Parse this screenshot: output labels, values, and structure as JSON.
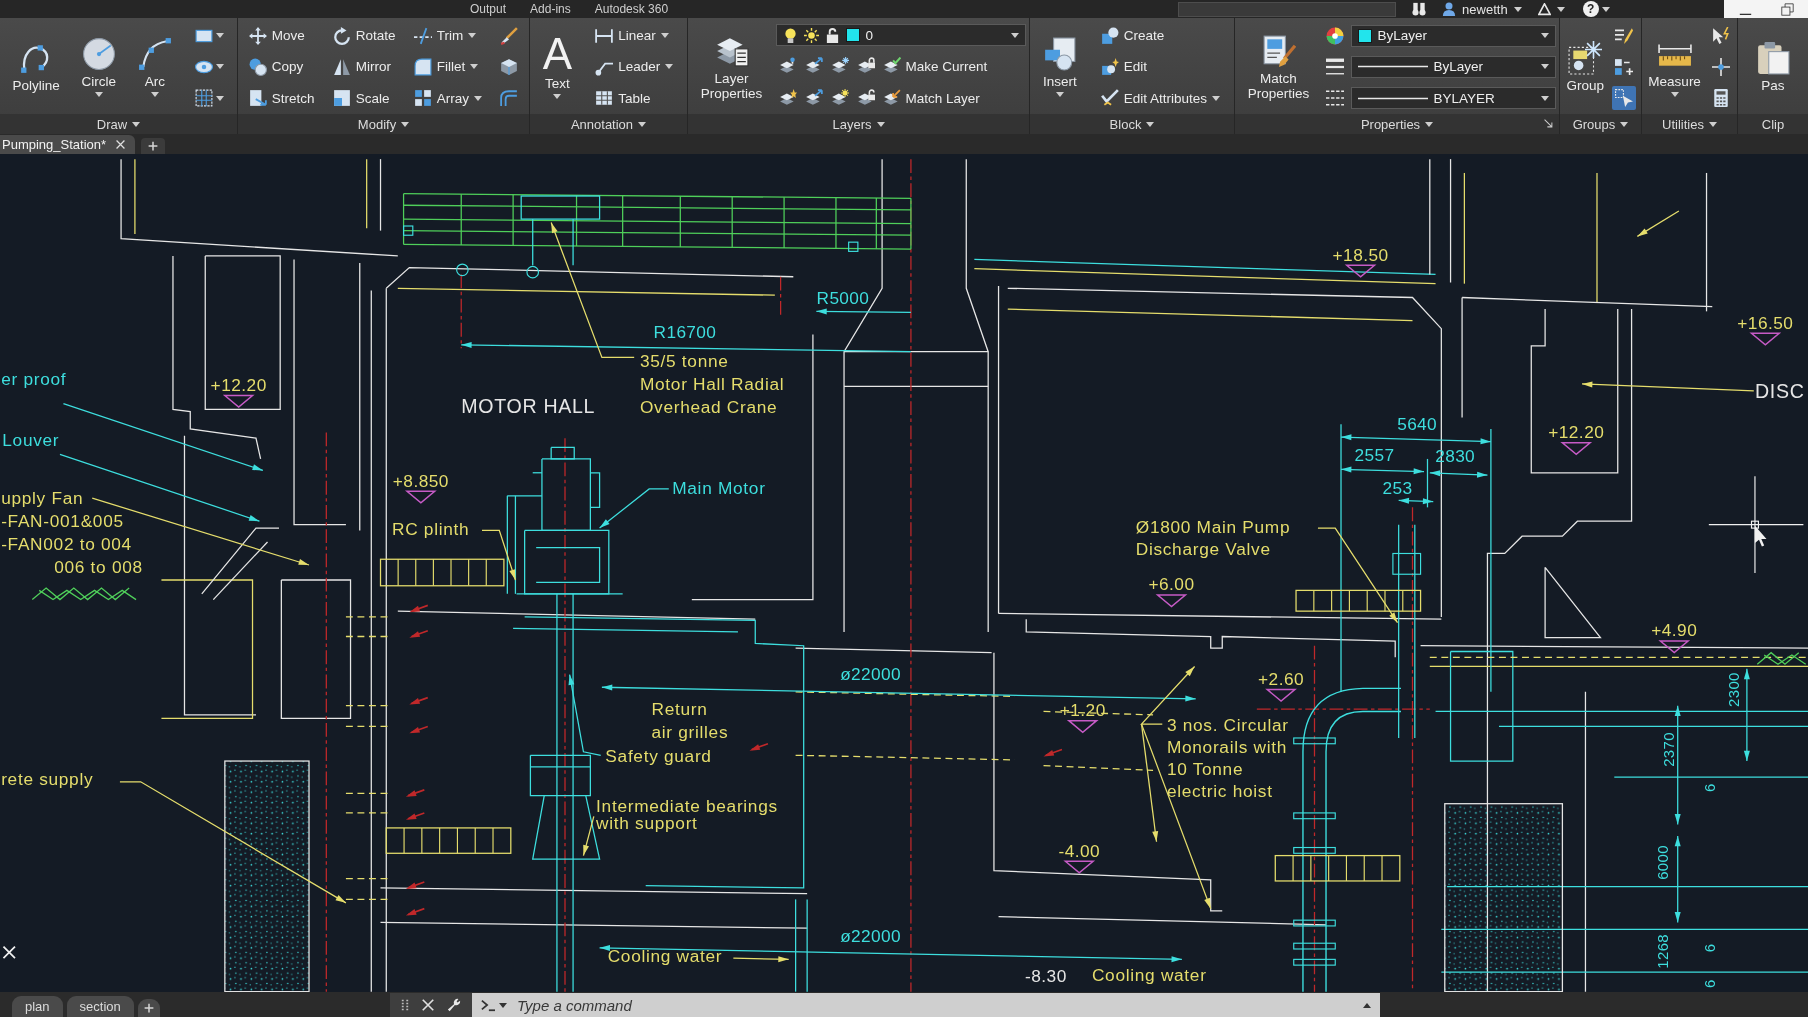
{
  "title_bar": {
    "ribbon_tabs": [
      "Output",
      "Add-ins",
      "Autodesk 360"
    ],
    "user": "newetth",
    "help": "?"
  },
  "ribbon": {
    "panels": [
      {
        "title": "Draw",
        "menu": true,
        "launcher": false,
        "columns": [
          [
            {
              "kind": "large",
              "label": "Polyline",
              "menu": false
            }
          ],
          [
            {
              "kind": "large",
              "label": "Circle",
              "menu": true
            }
          ],
          [
            {
              "kind": "large",
              "label": "Arc",
              "menu": true
            }
          ],
          [
            {
              "kind": "icon",
              "menu": true
            },
            {
              "kind": "icon",
              "menu": true
            },
            {
              "kind": "icon",
              "menu": true
            }
          ]
        ]
      },
      {
        "title": "Modify",
        "menu": true,
        "launcher": false,
        "columns": [
          [
            {
              "kind": "small",
              "label": "Move",
              "menu": false
            },
            {
              "kind": "small",
              "label": "Copy",
              "menu": false
            },
            {
              "kind": "small",
              "label": "Stretch",
              "menu": false
            }
          ],
          [
            {
              "kind": "small",
              "label": "Rotate",
              "menu": false
            },
            {
              "kind": "small",
              "label": "Mirror",
              "menu": false
            },
            {
              "kind": "small",
              "label": "Scale",
              "menu": false
            }
          ],
          [
            {
              "kind": "small",
              "label": "Trim",
              "menu": true
            },
            {
              "kind": "small",
              "label": "Fillet",
              "menu": true
            },
            {
              "kind": "small",
              "label": "Array",
              "menu": true
            }
          ],
          [
            {
              "kind": "icon",
              "menu": false
            },
            {
              "kind": "icon",
              "menu": false
            },
            {
              "kind": "icon",
              "menu": false
            }
          ]
        ]
      },
      {
        "title": "Annotation",
        "menu": true,
        "launcher": false,
        "columns": [
          [
            {
              "kind": "large",
              "glyph": "A",
              "label": "Text",
              "menu": true
            }
          ],
          [
            {
              "kind": "small",
              "label": "Linear",
              "menu": true
            },
            {
              "kind": "small",
              "label": "Leader",
              "menu": true
            },
            {
              "kind": "small",
              "label": "Table",
              "menu": false
            }
          ]
        ]
      },
      {
        "title": "Layers",
        "menu": true,
        "launcher": false,
        "columns": [
          [
            {
              "kind": "large",
              "label": "Layer Properties",
              "menu": false
            }
          ],
          [
            {
              "kind": "layer-combo",
              "value": "0",
              "color": "#22e4ec"
            },
            {
              "kind": "row",
              "tools": [
                {
                  "kind": "icon",
                  "menu": false
                },
                {
                  "kind": "icon",
                  "menu": false
                },
                {
                  "kind": "icon",
                  "menu": false
                },
                {
                  "kind": "icon",
                  "menu": false
                },
                {
                  "kind": "small",
                  "label": "Make Current",
                  "menu": false
                }
              ]
            },
            {
              "kind": "row",
              "tools": [
                {
                  "kind": "icon",
                  "menu": false
                },
                {
                  "kind": "icon",
                  "menu": false
                },
                {
                  "kind": "icon",
                  "menu": false
                },
                {
                  "kind": "icon",
                  "menu": false
                },
                {
                  "kind": "small",
                  "label": "Match Layer",
                  "menu": false
                }
              ]
            }
          ]
        ]
      },
      {
        "title": "Block",
        "menu": true,
        "launcher": false,
        "columns": [
          [
            {
              "kind": "large",
              "label": "Insert",
              "menu": true
            }
          ],
          [
            {
              "kind": "small",
              "label": "Create",
              "menu": false
            },
            {
              "kind": "small",
              "label": "Edit",
              "menu": false
            },
            {
              "kind": "small",
              "label": "Edit Attributes",
              "menu": true
            }
          ]
        ]
      },
      {
        "title": "Properties",
        "menu": true,
        "launcher": true,
        "columns": [
          [
            {
              "kind": "large",
              "label": "Match Properties",
              "menu": false
            }
          ],
          [
            {
              "kind": "icon",
              "menu": false
            },
            {
              "kind": "icon",
              "menu": false
            },
            {
              "kind": "icon",
              "menu": false
            }
          ],
          [
            {
              "kind": "color-combo",
              "value": "ByLayer",
              "color": "#22e4ec"
            },
            {
              "kind": "line-combo",
              "value": "ByLayer"
            },
            {
              "kind": "line-combo",
              "value": "BYLAYER"
            }
          ]
        ]
      },
      {
        "title": "Groups",
        "menu": true,
        "launcher": false,
        "columns": [
          [
            {
              "kind": "large",
              "label": "Group",
              "menu": false
            }
          ],
          [
            {
              "kind": "icon",
              "menu": false,
              "on": false
            },
            {
              "kind": "icon",
              "menu": false,
              "on": false
            },
            {
              "kind": "icon",
              "menu": false,
              "on": true
            }
          ]
        ]
      },
      {
        "title": "Utilities",
        "menu": true,
        "launcher": false,
        "columns": [
          [
            {
              "kind": "large",
              "label": "Measure",
              "menu": true
            }
          ],
          [
            {
              "kind": "icon",
              "menu": false
            },
            {
              "kind": "icon",
              "menu": false
            },
            {
              "kind": "icon",
              "menu": false
            }
          ]
        ]
      },
      {
        "title": "Clip",
        "menu": false,
        "launcher": false,
        "columns": [
          [
            {
              "kind": "large",
              "label": "Pas",
              "menu": false
            }
          ]
        ]
      }
    ]
  },
  "file_tabs": [
    {
      "label": "Pumping_Station*",
      "selected": true
    }
  ],
  "drawing": {
    "labels": [
      {
        "kind": "elevation",
        "text": "+18.50"
      },
      {
        "kind": "dimension",
        "text": "R5000"
      },
      {
        "kind": "dimension",
        "text": "R16700"
      },
      {
        "kind": "elevation",
        "text": "+16.50"
      },
      {
        "kind": "callout",
        "text": "er proof"
      },
      {
        "kind": "elevation",
        "text": "+12.20"
      },
      {
        "kind": "title",
        "text": "MOTOR HALL"
      },
      {
        "kind": "note",
        "lines": [
          "35/5 tonne",
          "Motor Hall Radial",
          "Overhead Crane"
        ]
      },
      {
        "kind": "title",
        "text": "DISC"
      },
      {
        "kind": "callout",
        "text": "Louver"
      },
      {
        "kind": "dimension",
        "text": "5640"
      },
      {
        "kind": "elevation",
        "text": "+12.20"
      },
      {
        "kind": "dimension",
        "text": "2557"
      },
      {
        "kind": "dimension",
        "text": "2830"
      },
      {
        "kind": "note",
        "lines": [
          "upply Fan",
          "-FAN-001&005",
          "-FAN002 to 004",
          "006 to 008"
        ]
      },
      {
        "kind": "elevation",
        "text": "+8.850"
      },
      {
        "kind": "callout",
        "text": "Main Motor"
      },
      {
        "kind": "dimension",
        "text": "253"
      },
      {
        "kind": "note",
        "text": "RC plinth"
      },
      {
        "kind": "note",
        "lines": [
          "Ø1800 Main Pump",
          "Discharge Valve"
        ]
      },
      {
        "kind": "elevation",
        "text": "+6.00"
      },
      {
        "kind": "elevation",
        "text": "+4.90"
      },
      {
        "kind": "dimension",
        "text": "ø22000"
      },
      {
        "kind": "elevation",
        "text": "+2.60"
      },
      {
        "kind": "note",
        "lines": [
          "Return",
          "air grilles"
        ]
      },
      {
        "kind": "note",
        "text": "Safety guard"
      },
      {
        "kind": "note",
        "text": "rete supply"
      },
      {
        "kind": "note",
        "lines": [
          "Intermediate bearings",
          "with support"
        ]
      },
      {
        "kind": "elevation",
        "text": "+1.20"
      },
      {
        "kind": "note",
        "lines": [
          "3 nos. Circular",
          "Monorails with",
          "10 Tonne",
          "electric hoist"
        ]
      },
      {
        "kind": "dimension-vertical",
        "text": "2300"
      },
      {
        "kind": "dimension-vertical",
        "text": "2370"
      },
      {
        "kind": "dimension-vertical",
        "text": "6"
      },
      {
        "kind": "elevation",
        "text": "-4.00"
      },
      {
        "kind": "dimension-vertical",
        "text": "6000"
      },
      {
        "kind": "note",
        "text": "Cooling water"
      },
      {
        "kind": "dimension",
        "text": "ø22000"
      },
      {
        "kind": "level",
        "text": "-8.30"
      },
      {
        "kind": "note",
        "text": "Cooling water"
      },
      {
        "kind": "dimension-vertical",
        "text": "1268"
      },
      {
        "kind": "dimension-vertical",
        "text": "6"
      },
      {
        "kind": "dimension-vertical",
        "text": "6"
      }
    ]
  },
  "command_line": {
    "placeholder": "Type a command"
  },
  "layout_tabs": [
    {
      "label": "plan",
      "selected": false
    },
    {
      "label": "section",
      "selected": false
    }
  ]
}
